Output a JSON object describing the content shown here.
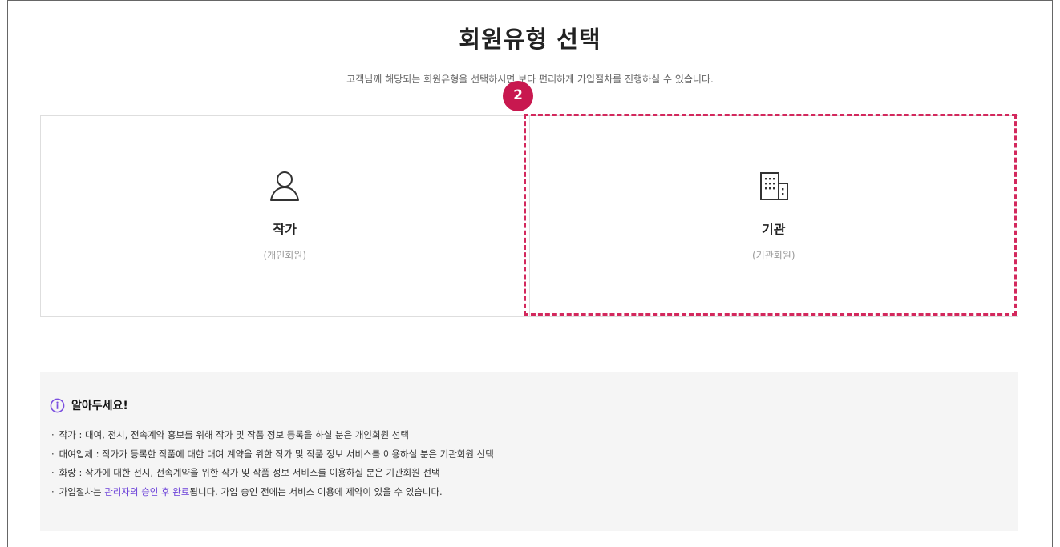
{
  "header": {
    "title": "회원유형 선택",
    "subtitle": "고객님께 해당되는 회원유형을 선택하시면 보다 편리하게 가입절차를 진행하실 수 있습니다."
  },
  "step_badge": "2",
  "cards": [
    {
      "icon": "person-icon",
      "title": "작가",
      "subtitle": "(개인회원)"
    },
    {
      "icon": "building-icon",
      "title": "기관",
      "subtitle": "(기관회원)"
    }
  ],
  "notice": {
    "icon": "info-icon",
    "title": "알아두세요!",
    "items": [
      "작가 : 대여, 전시, 전속계약 홍보를 위해 작가 및 작품 정보 등록을 하실 분은 개인회원 선택",
      "대여업체 : 작가가 등록한 작품에 대한 대여 계약을 위한 작가 및 작품 정보 서비스를 이용하실 분은 기관회원 선택",
      "화랑 : 작가에 대한 전시, 전속계약을 위한 작가 및 작품 정보 서비스를 이용하실 분은 기관회원 선택"
    ],
    "last_item": {
      "prefix": "가입절차는 ",
      "highlight": "관리자의 승인 후 완료",
      "suffix": "됩니다. 가입 승인 전에는 서비스 이용에 제약이 있을 수 있습니다."
    },
    "bullet": "·"
  },
  "colors": {
    "highlight_border": "#d3285d",
    "badge": "#c8184f",
    "accent_text": "#6a3fd8",
    "notice_bg": "#f5f5f5"
  }
}
